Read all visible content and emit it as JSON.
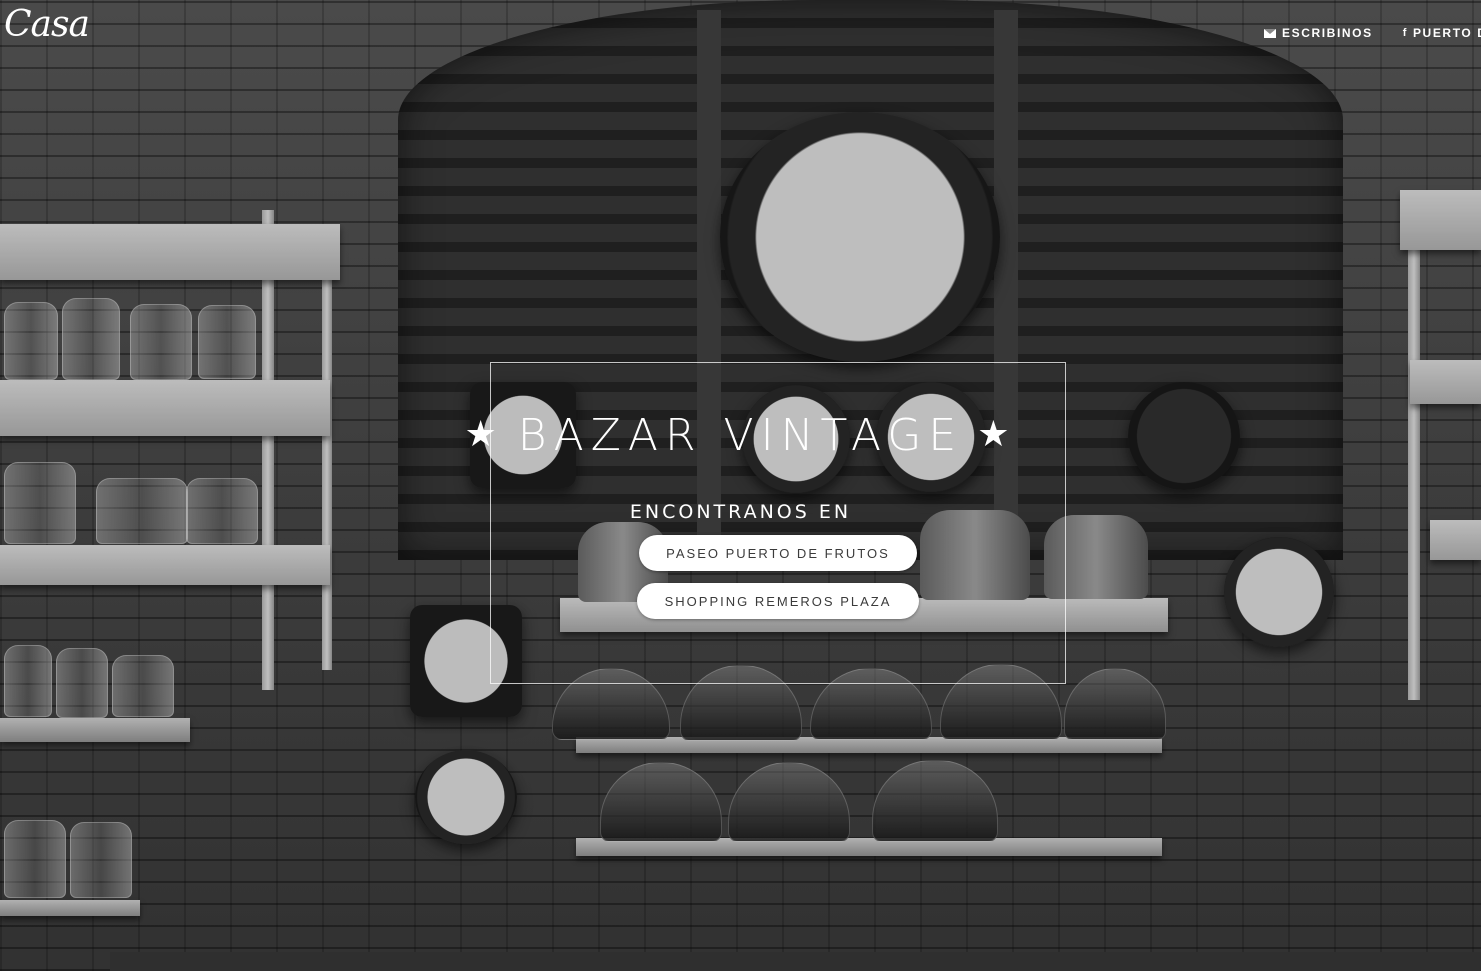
{
  "header": {
    "logo_text": "Casa"
  },
  "nav": {
    "items": [
      {
        "label": "ESCRIBINOS",
        "icon": "envelope-icon"
      },
      {
        "label": "PUERTO DE",
        "icon": "facebook-icon"
      }
    ]
  },
  "hero": {
    "title": "BAZAR VINTAGE",
    "star_glyph": "★",
    "subtitle": "ENCONTRANOS EN",
    "buttons": [
      {
        "label": "PASEO PUERTO DE FRUTOS"
      },
      {
        "label": "SHOPPING REMEROS PLAZA"
      }
    ]
  },
  "colors": {
    "text": "#ffffff",
    "button_bg": "#ffffff",
    "button_text": "#3b3b3b"
  }
}
